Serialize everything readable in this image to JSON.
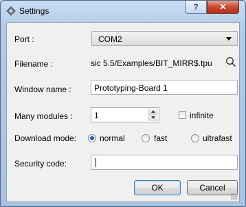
{
  "window": {
    "title": "Settings"
  },
  "titlebar": {
    "help_label": "?",
    "close_label": "✕"
  },
  "form": {
    "port": {
      "label": "Port :",
      "value": "COM2"
    },
    "filename": {
      "label": "Filename :",
      "value": "sic 5.5/Examples/BIT_MIRR$.tpu"
    },
    "window_name": {
      "label": "Window name :",
      "value": "Prototyping-Board 1"
    },
    "many_modules": {
      "label": "Many modules :",
      "value": "1",
      "infinite_label": "infinite",
      "infinite_checked": false
    },
    "download_mode": {
      "label": "Download mode:",
      "options": [
        "normal",
        "fast",
        "ultrafast"
      ],
      "selected": "normal"
    },
    "security_code": {
      "label": "Security code:",
      "value": ""
    }
  },
  "buttons": {
    "ok": "OK",
    "cancel": "Cancel"
  },
  "colors": {
    "accent": "#1e63b5",
    "close": "#c94a33"
  }
}
